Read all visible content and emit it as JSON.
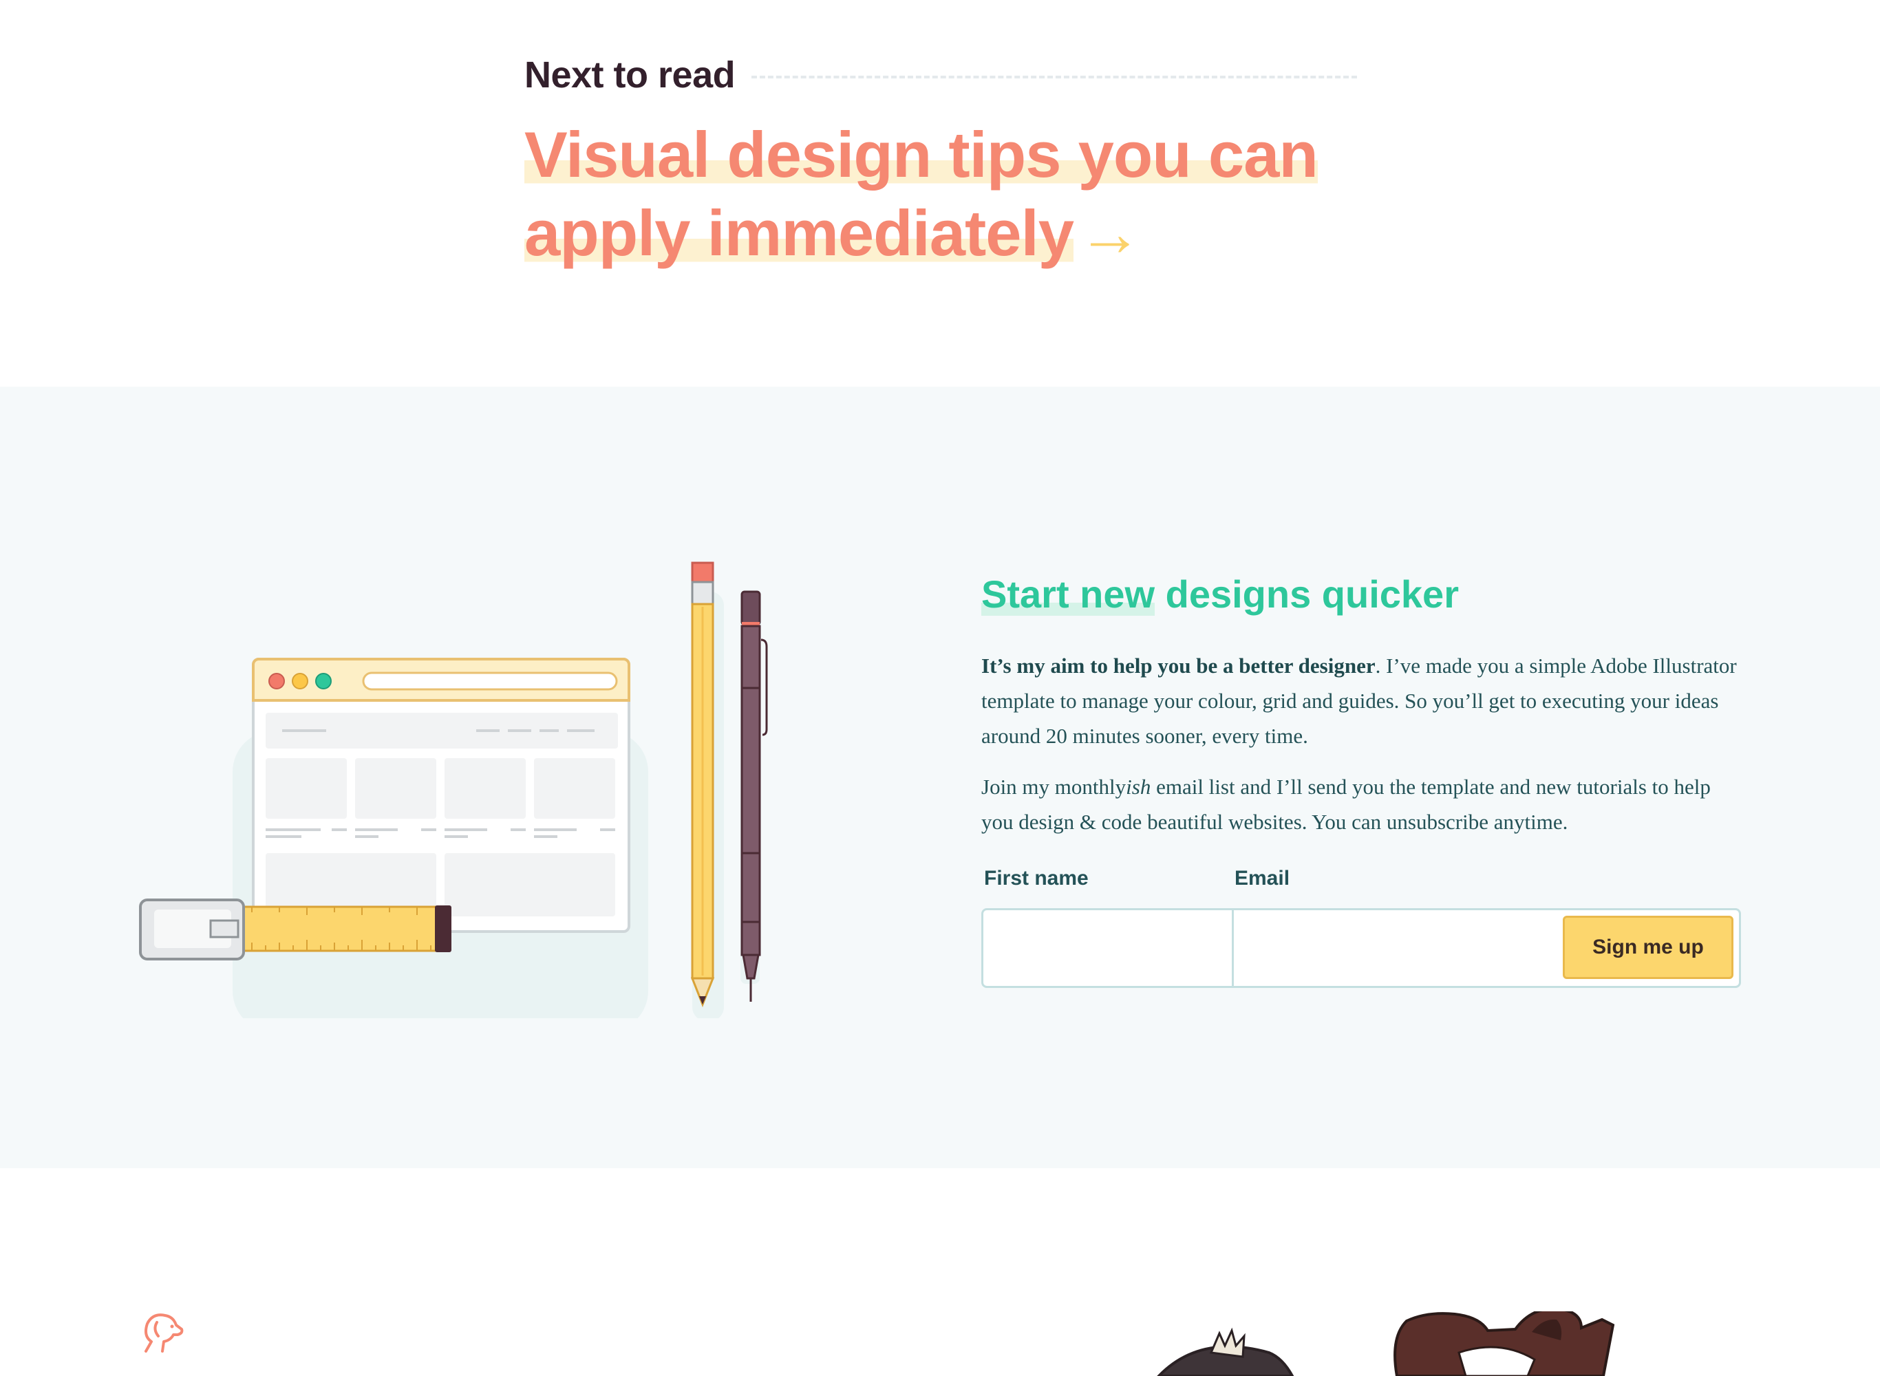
{
  "next": {
    "label": "Next to read",
    "title_line1": "Visual design tips you can",
    "title_line2": "apply immediately",
    "arrow": "→"
  },
  "subscribe": {
    "title_underlined": "Start new",
    "title_rest": " designs quicker",
    "intro_bold": "It’s my aim to help you be a better designer",
    "intro_rest": ". I’ve made you a simple Adobe Illustrator template to manage your colour, grid and guides. So you’ll get to executing your ideas around 20 minutes sooner, every time.",
    "join_before": "Join my monthly",
    "join_italic": "ish",
    "join_after": " email list and I’ll send you the template and new tutorials to help you design & code beautiful websites. You can unsubscribe anytime.",
    "first_name_label": "First name",
    "email_label": "Email",
    "first_name_value": "",
    "email_value": "",
    "button_label": "Sign me up"
  },
  "colors": {
    "accent_coral": "#f58872",
    "accent_green": "#2ec79b",
    "accent_yellow": "#fcd66d",
    "text_dark": "#33202c",
    "text_teal": "#245257",
    "section_bg": "#f5f9fa"
  },
  "icons": [
    "dog-logo-icon",
    "browser-window-icon",
    "tape-measure-icon",
    "pencil-icon",
    "mechanical-pen-icon",
    "dog-illustration"
  ]
}
